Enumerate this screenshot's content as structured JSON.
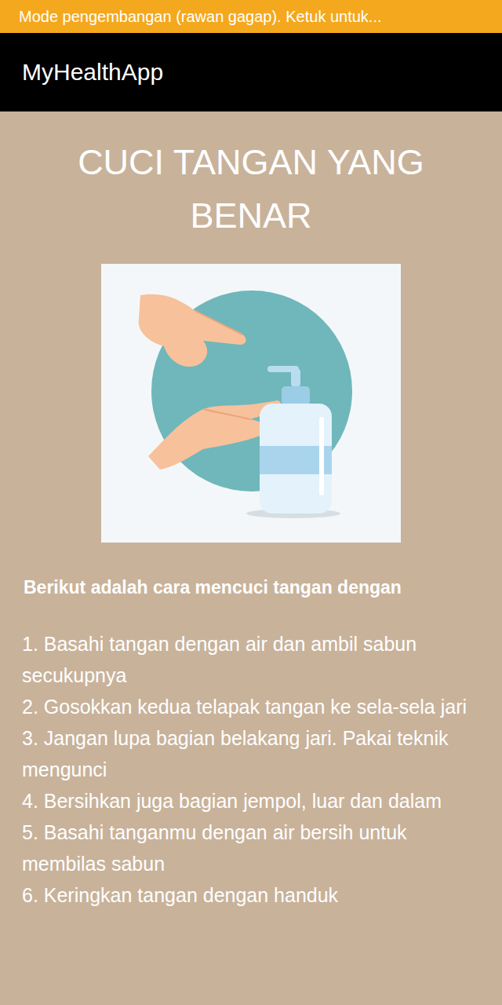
{
  "banner": {
    "text": "Mode pengembangan (rawan gagap). Ketuk untuk..."
  },
  "app_bar": {
    "title": "MyHealthApp"
  },
  "page": {
    "title": "CUCI TANGAN YANG BENAR",
    "intro": "Berikut adalah cara mencuci tangan dengan",
    "steps": [
      "1. Basahi tangan dengan air dan ambil sabun secukupnya",
      "2. Gosokkan kedua telapak tangan ke sela-sela jari",
      "3. Jangan lupa bagian belakang jari. Pakai teknik mengunci",
      "4. Bersihkan juga bagian jempol, luar dan dalam",
      "5. Basahi tanganmu dengan air bersih untuk membilas sabun",
      "6. Keringkan tangan dengan handuk"
    ]
  }
}
